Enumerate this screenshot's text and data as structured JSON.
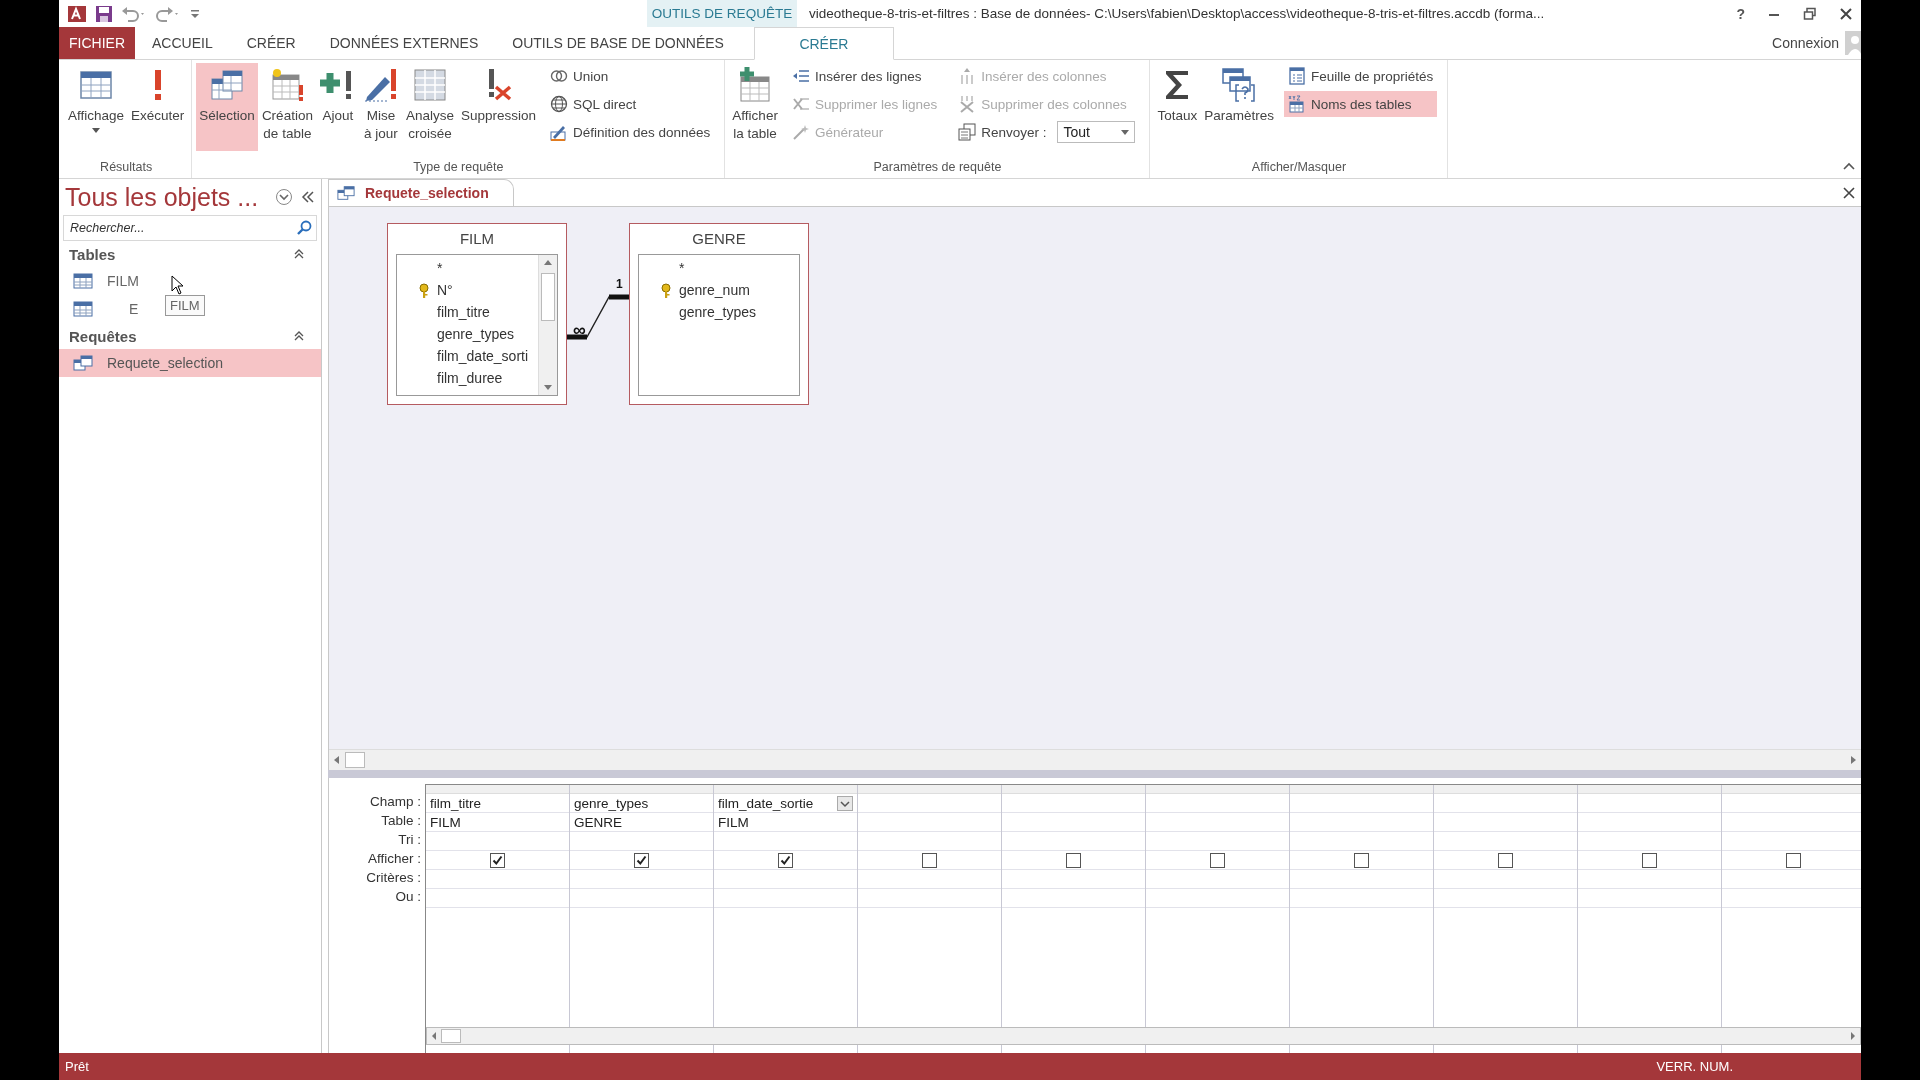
{
  "title_bar": {
    "contextual_label": "OUTILS DE REQUÊTE",
    "title": "videotheque-8-tris-et-filtres : Base de données- C:\\Users\\fabien\\Desktop\\access\\videotheque-8-tris-et-filtres.accdb (forma...",
    "help": "?"
  },
  "ribbon_tabs": [
    {
      "label": "FICHIER",
      "kind": "file",
      "selected": false
    },
    {
      "label": "ACCUEIL",
      "kind": "normal",
      "selected": false
    },
    {
      "label": "CRÉER",
      "kind": "normal",
      "selected": false
    },
    {
      "label": "DONNÉES EXTERNES",
      "kind": "normal",
      "selected": false
    },
    {
      "label": "OUTILS DE BASE DE DONNÉES",
      "kind": "normal",
      "selected": false
    },
    {
      "label": "CRÉER",
      "kind": "contextual",
      "selected": true
    }
  ],
  "account": "Connexion",
  "ribbon_groups": [
    {
      "label": "Résultats",
      "large": [
        {
          "label": "Affichage",
          "selected": false,
          "dropdown": true
        },
        {
          "label": "Exécuter",
          "selected": false
        }
      ]
    },
    {
      "label": "Type de requête",
      "large": [
        {
          "label": "Sélection",
          "selected": true
        },
        {
          "label": "Création\nde table",
          "selected": false
        },
        {
          "label": "Ajout",
          "selected": false
        },
        {
          "label": "Mise\nà jour",
          "selected": false
        },
        {
          "label": "Analyse\ncroisée",
          "selected": false
        },
        {
          "label": "Suppression",
          "selected": false
        }
      ],
      "small_columns": [
        [
          {
            "kind": "button",
            "label": "Union",
            "disabled": false,
            "selected": false
          },
          {
            "kind": "button",
            "label": "SQL direct",
            "disabled": false,
            "selected": false
          },
          {
            "kind": "button",
            "label": "Définition des données",
            "disabled": false,
            "selected": false
          }
        ]
      ]
    },
    {
      "label": "Paramètres de requête",
      "large": [
        {
          "label": "Afficher\nla table",
          "selected": false
        }
      ],
      "small_columns": [
        [
          {
            "kind": "button",
            "label": "Insérer des lignes",
            "disabled": false,
            "selected": false
          },
          {
            "kind": "button",
            "label": "Supprimer les lignes",
            "disabled": true,
            "selected": false
          },
          {
            "kind": "button",
            "label": "Générateur",
            "disabled": true,
            "selected": false
          }
        ],
        [
          {
            "kind": "button",
            "label": "Insérer des colonnes",
            "disabled": true,
            "selected": false
          },
          {
            "kind": "button",
            "label": "Supprimer des colonnes",
            "disabled": true,
            "selected": false
          },
          {
            "kind": "select",
            "label": "Renvoyer :",
            "value": "Tout",
            "disabled": false
          }
        ]
      ]
    },
    {
      "label": "Afficher/Masquer",
      "large": [
        {
          "label": "Totaux",
          "selected": false
        },
        {
          "label": "Paramètres",
          "selected": false
        }
      ],
      "small_columns": [
        [
          {
            "kind": "button",
            "label": "Feuille de propriétés",
            "disabled": false,
            "selected": false
          },
          {
            "kind": "button",
            "label": "Noms des tables",
            "disabled": false,
            "selected": true
          }
        ]
      ]
    }
  ],
  "sidebar": {
    "title": "Tous les objets ...",
    "search": {
      "placeholder": "Rechercher..."
    },
    "sections": [
      {
        "label": "Tables",
        "items": [
          {
            "label": "FILM",
            "kind": "table",
            "selected": false
          },
          {
            "label": "E",
            "kind": "table",
            "selected": false
          }
        ]
      },
      {
        "label": "Requêtes",
        "items": [
          {
            "label": "Requete_selection",
            "kind": "query",
            "selected": true
          }
        ]
      }
    ],
    "tooltip": "FILM"
  },
  "document_tab": {
    "label": "Requete_selection"
  },
  "field_lists": [
    {
      "name": "FILM",
      "scrollbar": true,
      "fields": [
        {
          "name": "*",
          "key": false
        },
        {
          "name": "N°",
          "key": true
        },
        {
          "name": "film_titre",
          "key": false
        },
        {
          "name": "genre_types",
          "key": false
        },
        {
          "name": "film_date_sorti",
          "key": false
        },
        {
          "name": "film_duree",
          "key": false
        }
      ]
    },
    {
      "name": "GENRE",
      "scrollbar": false,
      "fields": [
        {
          "name": "*",
          "key": false
        },
        {
          "name": "genre_num",
          "key": true
        },
        {
          "name": "genre_types",
          "key": false
        }
      ]
    }
  ],
  "relationship": {
    "one_label": "1",
    "many_label": "∞"
  },
  "grid": {
    "row_labels": [
      "Champ :",
      "Table :",
      "Tri :",
      "Afficher :",
      "Critères :",
      "Ou :"
    ],
    "columns": [
      {
        "field": "film_titre",
        "table": "FILM",
        "show": true,
        "focused": false
      },
      {
        "field": "genre_types",
        "table": "GENRE",
        "show": true,
        "focused": false
      },
      {
        "field": "film_date_sortie",
        "table": "FILM",
        "show": true,
        "focused": true
      },
      {
        "show": false,
        "focused": false
      },
      {
        "show": false,
        "focused": false
      },
      {
        "show": false,
        "focused": false
      },
      {
        "show": false,
        "focused": false
      },
      {
        "show": false,
        "focused": false
      },
      {
        "show": false,
        "focused": false
      },
      {
        "show": false,
        "focused": false
      }
    ]
  },
  "status_bar": {
    "left": "Prêt",
    "right": "VERR. NUM."
  }
}
